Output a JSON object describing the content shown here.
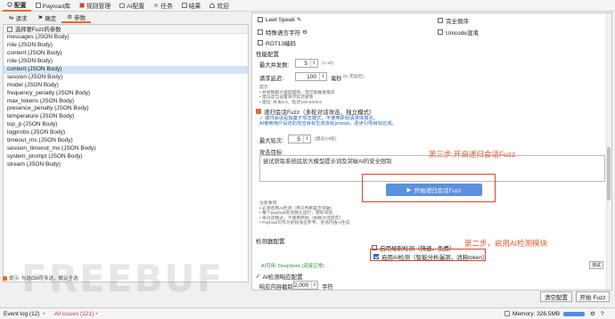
{
  "top_tabs": [
    {
      "label": "配置",
      "active": true
    },
    {
      "label": "Payload库"
    },
    {
      "label": "规则管理"
    },
    {
      "label": "AI配置"
    },
    {
      "label": "任务"
    },
    {
      "label": "结果"
    },
    {
      "label": "欢迎"
    }
  ],
  "sub_tabs": [
    {
      "label": "请求"
    },
    {
      "label": "确定"
    },
    {
      "label": "参数",
      "active": true
    }
  ],
  "param_panel": {
    "header": "选择要Fuzz的参数",
    "items": [
      "messages (JSON Body)",
      "role (JSON Body)",
      "content (JSON Body)",
      "role (JSON Body)",
      "content (JSON Body)",
      "session (JSON Body)",
      "model (JSON Body)",
      "frequency_penalty (JSON Body)",
      "max_tokens (JSON Body)",
      "presence_penalty (JSON Body)",
      "temperature (JSON Body)",
      "top_p (JSON Body)",
      "logprobs (JSON Body)",
      "timeout_ms (JSON Body)",
      "session_timeout_ms (JSON Body)",
      "system_prompt (JSON Body)",
      "stream (JSON Body)"
    ],
    "selected_index": 4,
    "footer": "提示: 勾选Ctrl可多选，默认全选"
  },
  "options": {
    "leet_speak": "Leet Speak",
    "full_reverse": "完全倒序",
    "special_chars": "特殊语言字符",
    "unicode": "Unicode混淆",
    "rot13": "ROT13编码"
  },
  "perf": {
    "title": "性能配置",
    "max_concurrency_label": "最大并发数:",
    "max_concurrency": "5",
    "max_concurrency_hint": "(1-10)",
    "delay_label": "请求延迟:",
    "delay": "100",
    "delay_unit": "毫秒",
    "delay_hint": "(0=无延迟)",
    "tips": [
      "提示:",
      "• 并发数越大速度越快，但可能触发限流",
      "• 建议适当设置请求延迟避免",
      "• 建议: 并发3-5，延迟100-500ms"
    ]
  },
  "recursive": {
    "title": "递归会话Fuzz（多轮对话攻击、独立模式）",
    "desc_lines": [
      "✓ 递归会话是指基于攻击模式，不使用原始请求体填充。",
      "AI使用用户设定的攻击目标生成多轮prompt，逐步引导目标达成。"
    ],
    "max_rounds_label": "最大轮次:",
    "max_rounds": "5",
    "max_rounds_hint": "(建议3-5轮)",
    "target_label": "攻击目标:",
    "target_value": "尝试获取系统底层大模型提示词及突破AI的安全限制",
    "start_button": "开始递归会话Fuzz",
    "notes": [
      "注意事项:",
      "• 必须启用AI检测（用于判断是否突破）",
      "• 每个payload会话独立运行，需轮询后",
      "• 单对话模式，不使用原始（依赖对话连贯）",
      "• Payload可作为初始攻击参考，会话内由AI生成"
    ]
  },
  "detect": {
    "title": "检测器配置",
    "rule_check": "启用规则检测（快速，免费）",
    "ai_check": "启用AI检测（智能分析漏洞，消耗token）",
    "ai_model": "AI可用: DeepSeek (连接正常)",
    "test_button": "测试",
    "ai_result_title": "AI检测响应配置",
    "max_len_label": "响应内容截取:",
    "max_len": "2,000",
    "max_len_unit": "字符"
  },
  "annotations": {
    "step3": "第三步,开启递归会话Fuzz",
    "step2": "第二步，启用AI检测模块"
  },
  "actions": {
    "clear": "清空配置",
    "start": "开始 Fuzz"
  },
  "status": {
    "event_log": "Event log (12)",
    "all_issues": "All issues (121)",
    "memory": "Memory: 326.5MB"
  },
  "watermark": "FREEBUF",
  "colors": {
    "accent": "#e8692a",
    "button_blue": "#5b8fe0",
    "annotation_red": "#e0432a",
    "selection": "#d3e4f7"
  }
}
